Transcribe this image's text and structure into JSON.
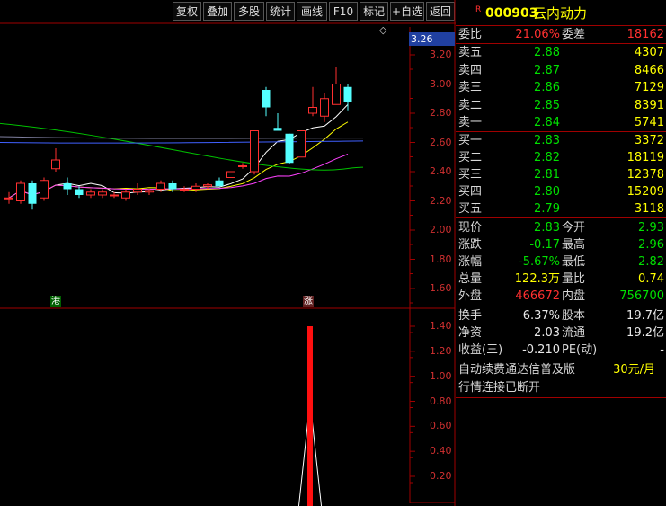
{
  "toolbar": {
    "buttons": [
      "复权",
      "叠加",
      "多股",
      "统计",
      "画线",
      "F10",
      "标记",
      "+自选",
      "返回"
    ]
  },
  "chart": {
    "price_axis": [
      "3.20",
      "3.00",
      "2.80",
      "2.60",
      "2.40",
      "2.20",
      "2.00",
      "1.80",
      "1.60"
    ],
    "current_price_tag": "3.26",
    "indicator_axis": [
      "1.40",
      "1.20",
      "1.00",
      "0.80",
      "0.60",
      "0.40",
      "0.20"
    ],
    "markers": {
      "gang": "港",
      "zhang": "涨"
    },
    "diamond": "◇"
  },
  "chart_data": {
    "type": "candlestick",
    "ylim": [
      1.5,
      3.3
    ],
    "candles": [
      {
        "o": 2.22,
        "h": 2.26,
        "l": 2.18,
        "c": 2.22
      },
      {
        "o": 2.2,
        "h": 2.34,
        "l": 2.18,
        "c": 2.32
      },
      {
        "o": 2.32,
        "h": 2.34,
        "l": 2.14,
        "c": 2.18
      },
      {
        "o": 2.22,
        "h": 2.36,
        "l": 2.2,
        "c": 2.34
      },
      {
        "o": 2.42,
        "h": 2.56,
        "l": 2.4,
        "c": 2.48
      },
      {
        "o": 2.32,
        "h": 2.36,
        "l": 2.24,
        "c": 2.28
      },
      {
        "o": 2.28,
        "h": 2.3,
        "l": 2.22,
        "c": 2.24
      },
      {
        "o": 2.24,
        "h": 2.28,
        "l": 2.22,
        "c": 2.26
      },
      {
        "o": 2.24,
        "h": 2.28,
        "l": 2.22,
        "c": 2.26
      },
      {
        "o": 2.24,
        "h": 2.26,
        "l": 2.22,
        "c": 2.24
      },
      {
        "o": 2.22,
        "h": 2.28,
        "l": 2.2,
        "c": 2.26
      },
      {
        "o": 2.26,
        "h": 2.32,
        "l": 2.24,
        "c": 2.28
      },
      {
        "o": 2.26,
        "h": 2.28,
        "l": 2.24,
        "c": 2.27
      },
      {
        "o": 2.28,
        "h": 2.34,
        "l": 2.26,
        "c": 2.32
      },
      {
        "o": 2.32,
        "h": 2.34,
        "l": 2.26,
        "c": 2.28
      },
      {
        "o": 2.28,
        "h": 2.3,
        "l": 2.26,
        "c": 2.28
      },
      {
        "o": 2.28,
        "h": 2.32,
        "l": 2.26,
        "c": 2.3
      },
      {
        "o": 2.3,
        "h": 2.32,
        "l": 2.28,
        "c": 2.31
      },
      {
        "o": 2.34,
        "h": 2.36,
        "l": 2.3,
        "c": 2.3
      },
      {
        "o": 2.36,
        "h": 2.4,
        "l": 2.36,
        "c": 2.4
      },
      {
        "o": 2.44,
        "h": 2.46,
        "l": 2.42,
        "c": 2.44
      },
      {
        "o": 2.4,
        "h": 2.68,
        "l": 2.38,
        "c": 2.68
      },
      {
        "o": 2.96,
        "h": 2.98,
        "l": 2.78,
        "c": 2.84
      },
      {
        "o": 2.7,
        "h": 2.8,
        "l": 2.68,
        "c": 2.68
      },
      {
        "o": 2.66,
        "h": 2.66,
        "l": 2.45,
        "c": 2.46
      },
      {
        "o": 2.5,
        "h": 2.68,
        "l": 2.5,
        "c": 2.68
      },
      {
        "o": 2.8,
        "h": 2.98,
        "l": 2.78,
        "c": 2.84
      },
      {
        "o": 2.78,
        "h": 2.94,
        "l": 2.74,
        "c": 2.9
      },
      {
        "o": 2.86,
        "h": 3.12,
        "l": 2.86,
        "c": 3.0
      },
      {
        "o": 2.98,
        "h": 3.0,
        "l": 2.82,
        "c": 2.88
      }
    ],
    "indicator": {
      "spike_value": 1.4,
      "peak_value": 0.8
    }
  },
  "panel": {
    "stock_code": "000903",
    "stock_name": "云内动力",
    "badge": "R",
    "weibi_label": "委比",
    "weibi_value": "21.06%",
    "weicha_label": "委差",
    "weicha_value": "18162",
    "asks": [
      {
        "label": "卖五",
        "price": "2.88",
        "vol": "4307"
      },
      {
        "label": "卖四",
        "price": "2.87",
        "vol": "8466"
      },
      {
        "label": "卖三",
        "price": "2.86",
        "vol": "7129"
      },
      {
        "label": "卖二",
        "price": "2.85",
        "vol": "8391"
      },
      {
        "label": "卖一",
        "price": "2.84",
        "vol": "5741"
      }
    ],
    "bids": [
      {
        "label": "买一",
        "price": "2.83",
        "vol": "3372"
      },
      {
        "label": "买二",
        "price": "2.82",
        "vol": "18119"
      },
      {
        "label": "买三",
        "price": "2.81",
        "vol": "12378"
      },
      {
        "label": "买四",
        "price": "2.80",
        "vol": "15209"
      },
      {
        "label": "买五",
        "price": "2.79",
        "vol": "3118"
      }
    ],
    "quote": {
      "xianjia_l": "现价",
      "xianjia": "2.83",
      "jinkai_l": "今开",
      "jinkai": "2.93",
      "zhangdie_l": "涨跌",
      "zhangdie": "-0.17",
      "zuigao_l": "最高",
      "zuigao": "2.96",
      "zhangfu_l": "涨幅",
      "zhangfu": "-5.67%",
      "zuidi_l": "最低",
      "zuidi": "2.82",
      "zongliang_l": "总量",
      "zongliang": "122.3万",
      "liangbi_l": "量比",
      "liangbi": "0.74",
      "waipan_l": "外盘",
      "waipan": "466672",
      "neipan_l": "内盘",
      "neipan": "756700"
    },
    "fund": {
      "huanshou_l": "换手",
      "huanshou": "6.37%",
      "guben_l": "股本",
      "guben": "19.7亿",
      "jingzi_l": "净资",
      "jingzi": "2.03",
      "liutong_l": "流通",
      "liutong": "19.2亿",
      "shouyi_l": "收益(三)",
      "shouyi": "-0.210",
      "pe_l": "PE(动)",
      "pe": "-"
    },
    "promo": {
      "text": "自动续费通达信普及版",
      "price": "30元/月"
    },
    "status": "行情连接已断开"
  },
  "colors": {
    "up": "#ff3030",
    "down": "#54ffff",
    "bg": "#000000",
    "grid": "#a00000",
    "ma1": "#ffffff",
    "ma2": "#ffff00",
    "ma3": "#00c000",
    "ma4": "#ff40ff",
    "ma5": "#4060ff"
  }
}
